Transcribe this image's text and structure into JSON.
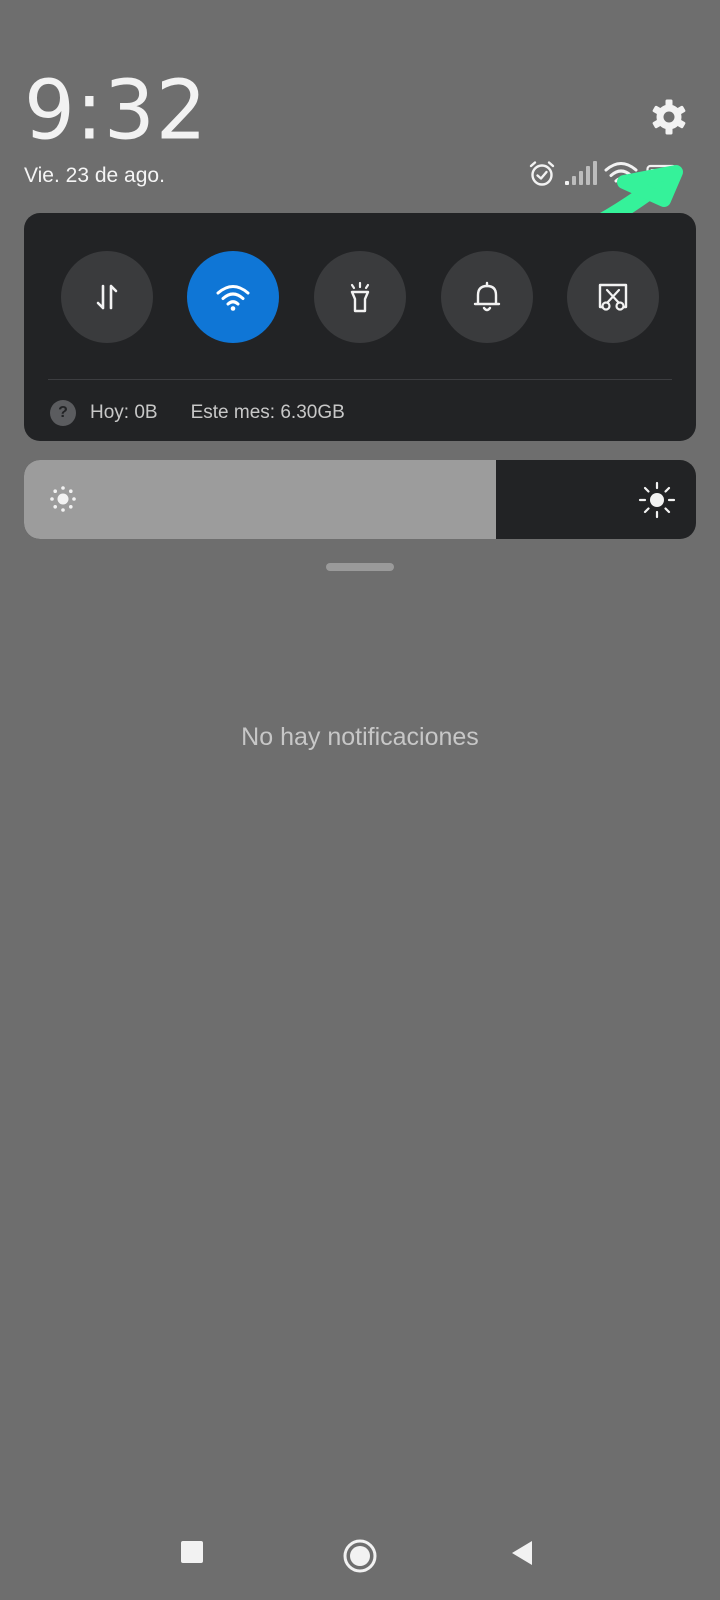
{
  "status_bar": {
    "time": "9:32",
    "date": "Vie. 23 de ago.",
    "icons": [
      "alarm-icon",
      "cellular-signal-icon",
      "wifi-signal-icon",
      "battery-icon"
    ]
  },
  "settings_icon": "gear-icon",
  "quick_toggles": [
    {
      "name": "mobile-data",
      "icon": "data-arrows-icon",
      "active": false
    },
    {
      "name": "wifi",
      "icon": "wifi-icon",
      "active": true
    },
    {
      "name": "flashlight",
      "icon": "flashlight-icon",
      "active": false
    },
    {
      "name": "sound",
      "icon": "bell-icon",
      "active": false
    },
    {
      "name": "screenshot",
      "icon": "scissors-screen-icon",
      "active": false
    }
  ],
  "data_usage": {
    "today": "Hoy: 0B",
    "month": "Este mes: 6.30GB"
  },
  "brightness": {
    "level": 0.703
  },
  "notifications": {
    "empty_message": "No hay notificaciones"
  },
  "annotation": {
    "arrow_color": "#35f29a"
  },
  "colors": {
    "accent": "#0f76d6",
    "panel": "#222325",
    "background": "#6e6e6e"
  },
  "nav_bar": [
    "recents-square-icon",
    "home-circle-icon",
    "back-triangle-icon"
  ]
}
